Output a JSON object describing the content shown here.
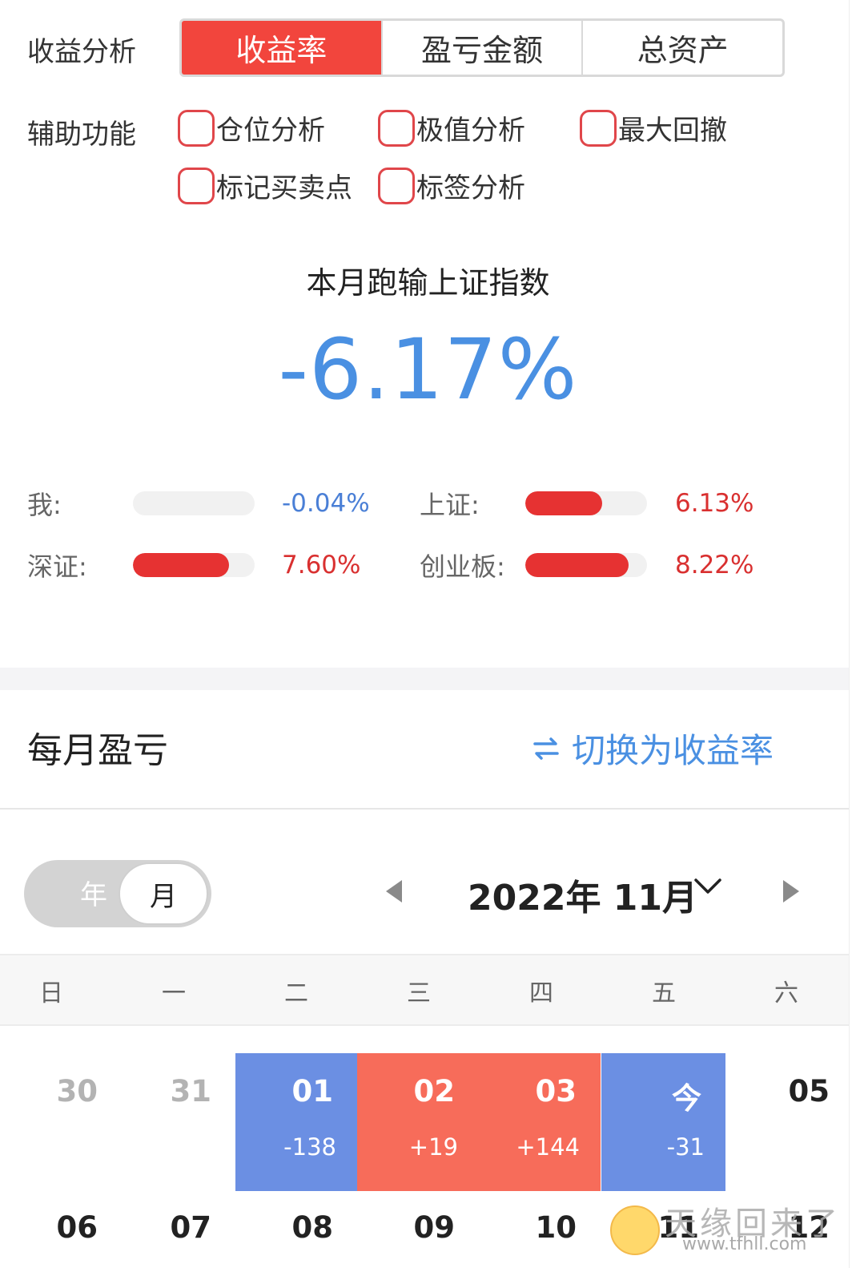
{
  "analysis": {
    "label": "收益分析",
    "tabs": [
      "收益率",
      "盈亏金额",
      "总资产"
    ],
    "active_tab": 0
  },
  "aux": {
    "label": "辅助功能",
    "options": [
      "仓位分析",
      "极值分析",
      "最大回撤",
      "标记买卖点",
      "标签分析"
    ]
  },
  "compare": {
    "title": "本月跑输上证指数",
    "value": "-6.17%"
  },
  "benchmarks": [
    {
      "name": "我:",
      "value": "-0.04%",
      "fill": 0.0,
      "sign": "neg"
    },
    {
      "name": "上证:",
      "value": "6.13%",
      "fill": 0.63,
      "sign": "pos"
    },
    {
      "name": "深证:",
      "value": "7.60%",
      "fill": 0.79,
      "sign": "pos"
    },
    {
      "name": "创业板:",
      "value": "8.22%",
      "fill": 0.85,
      "sign": "pos"
    }
  ],
  "monthly": {
    "title": "每月盈亏",
    "switch_label": "切换为收益率"
  },
  "toggle": {
    "year": "年",
    "month": "月"
  },
  "calendar": {
    "month_label": "2022年 11月",
    "weekdays": [
      "日",
      "一",
      "二",
      "三",
      "四",
      "五",
      "六"
    ],
    "row1": [
      {
        "day": "30",
        "style": "grey"
      },
      {
        "day": "31",
        "style": "grey"
      },
      {
        "day": "01",
        "style": "loss",
        "pnl": "-138"
      },
      {
        "day": "02",
        "style": "gain",
        "pnl": "+19"
      },
      {
        "day": "03",
        "style": "gain",
        "pnl": "+144"
      },
      {
        "day": "今",
        "style": "loss",
        "pnl": "-31"
      },
      {
        "day": "05",
        "style": "dark"
      }
    ],
    "row2": [
      "06",
      "07",
      "08",
      "09",
      "10",
      "11",
      "12"
    ]
  },
  "watermark": {
    "text": "天缘回来了",
    "url": "www.tfhll.com"
  },
  "colors": {
    "accent_red": "#f2453d",
    "loss_blue": "#6b8fe3",
    "gain_red": "#f76c5a",
    "link_blue": "#4a90e2"
  }
}
